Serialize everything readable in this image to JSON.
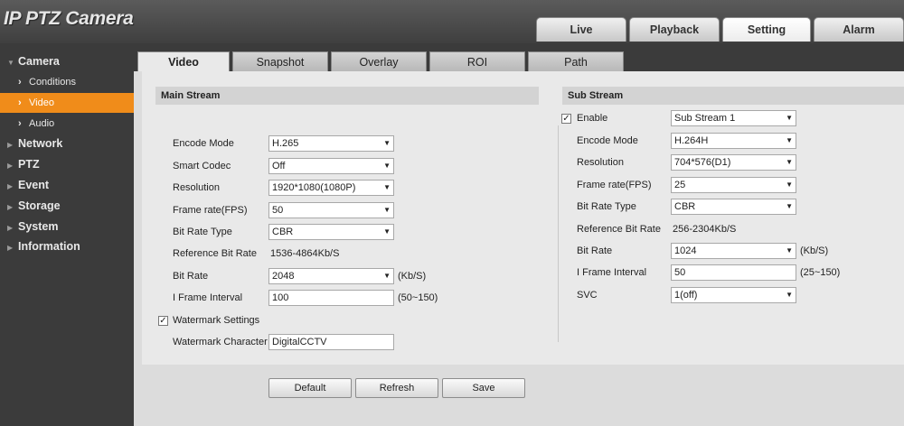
{
  "app": {
    "title": "IP PTZ Camera"
  },
  "main_tabs": [
    {
      "label": "Live"
    },
    {
      "label": "Playback"
    },
    {
      "label": "Setting"
    },
    {
      "label": "Alarm"
    }
  ],
  "sidebar": {
    "camera": "Camera",
    "camera_items": [
      "Conditions",
      "Video",
      "Audio"
    ],
    "sections": [
      "Network",
      "PTZ",
      "Event",
      "Storage",
      "System",
      "Information"
    ]
  },
  "sub_tabs": [
    "Video",
    "Snapshot",
    "Overlay",
    "ROI",
    "Path"
  ],
  "main_stream": {
    "title": "Main Stream",
    "encode_mode": {
      "label": "Encode Mode",
      "value": "H.265"
    },
    "smart_codec": {
      "label": "Smart Codec",
      "value": "Off"
    },
    "resolution": {
      "label": "Resolution",
      "value": "1920*1080(1080P)"
    },
    "frame_rate": {
      "label": "Frame rate(FPS)",
      "value": "50"
    },
    "bit_rate_type": {
      "label": "Bit Rate Type",
      "value": "CBR"
    },
    "reference_bit_rate": {
      "label": "Reference Bit Rate",
      "value": "1536-4864Kb/S"
    },
    "bit_rate": {
      "label": "Bit Rate",
      "value": "2048",
      "unit": "(Kb/S)"
    },
    "i_frame_interval": {
      "label": "I Frame Interval",
      "value": "100",
      "range": "(50~150)"
    },
    "watermark_settings": {
      "label": "Watermark Settings",
      "checked": "✓"
    },
    "watermark_character": {
      "label": "Watermark Character",
      "value": "DigitalCCTV"
    }
  },
  "sub_stream": {
    "title": "Sub Stream",
    "enable": {
      "label": "Enable",
      "checked": "✓",
      "value": "Sub Stream 1"
    },
    "encode_mode": {
      "label": "Encode Mode",
      "value": "H.264H"
    },
    "resolution": {
      "label": "Resolution",
      "value": "704*576(D1)"
    },
    "frame_rate": {
      "label": "Frame rate(FPS)",
      "value": "25"
    },
    "bit_rate_type": {
      "label": "Bit Rate Type",
      "value": "CBR"
    },
    "reference_bit_rate": {
      "label": "Reference Bit Rate",
      "value": "256-2304Kb/S"
    },
    "bit_rate": {
      "label": "Bit Rate",
      "value": "1024",
      "unit": "(Kb/S)"
    },
    "i_frame_interval": {
      "label": "I Frame Interval",
      "value": "50",
      "range": "(25~150)"
    },
    "svc": {
      "label": "SVC",
      "value": "1(off)"
    }
  },
  "buttons": {
    "default": "Default",
    "refresh": "Refresh",
    "save": "Save"
  },
  "colors": {
    "accent": "#f08c1a",
    "sidebar": "#3b3b3b",
    "header": "#4a4a4a"
  }
}
